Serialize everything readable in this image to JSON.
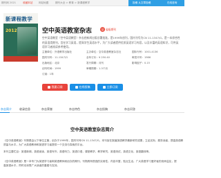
{
  "topbar": {
    "site": "期刊网 2021",
    "link1": "收藏本站",
    "link2": "网站地图",
    "link3": "期刊大全 > 教育 > 新课程教学",
    "right1": "投稿 从文章投稿",
    "right2": "在线咨询"
  },
  "cover": {
    "title": "新课程教学",
    "year": "2012.7"
  },
  "magazine": {
    "title": "空中英语教室杂志",
    "badge_icon": "证",
    "badge_text": "省级期刊",
    "description": "空中英语教室（空中英语教室）杂志经新闻出版总署批准，是1999年创刊，国内刊号为CN 11-1347/G，是一本综合性的英语类期刊，旨在学习英语，提高学生英语水平，为广大读者提供优质英语学习内容，以及丰富的英语知识，可供英语学习者阅读参考使用。"
  },
  "info": {
    "r1c1": "主管单位：外语教学出版社",
    "r1c2": "主办单位：空中英语教室杂志社",
    "r1c3": "国际刊号：1001-4136",
    "r2c1": "国内刊号：11-1347/G",
    "r2c2": "全年订价：¥ 250.40",
    "r2c3": "邮发代号：1986",
    "r3c1": "出版地区：北京",
    "r3c2": "发行周期：月刊",
    "r3c3": "影响因子：0.15",
    "r4c1": "创刊时间：1999",
    "r4c2": "审稿周期：1-3个月",
    "r4c3": "",
    "r5c1": "订阅：1年"
  },
  "buttons": {
    "subscribe": "我要订阅",
    "submit": "在线投稿",
    "consult": "立即订阅"
  },
  "tabs": [
    "杂志简介",
    "收录信息",
    "杂志荣誉",
    "杂志特色",
    "杂志投稿",
    "杂志问答"
  ],
  "content": {
    "heading": "空中英语教室杂志简介",
    "p1": "《空中英语教室》刊物是由以下单位主管，创办于1999年，国内刊号CN 11-1347/G，本刊旨在报道英语教学最新研究成果，立足实际，服务读者，提高英语教学",
    "p2": "质量与水平，为广大英语教师和英语学习者提供一个交流与探索的平台。",
    "p3": "本刊主要栏目：英语新闻，英语阅读，英语写作，英语听力，英语口语，课堂教学，教学研究，英语测试，英语文化，英语翻译等。",
    "p4": "《空中英语教室》是一本专门为英语学习者和英语教师而创办的期刊，刊物具有很强的实用性，内容丰富，贴近生活，广大英语学习爱好者的良师益友，提",
    "p5": "高英语水平，同时也深受广大读者的喜爱与支持。"
  }
}
